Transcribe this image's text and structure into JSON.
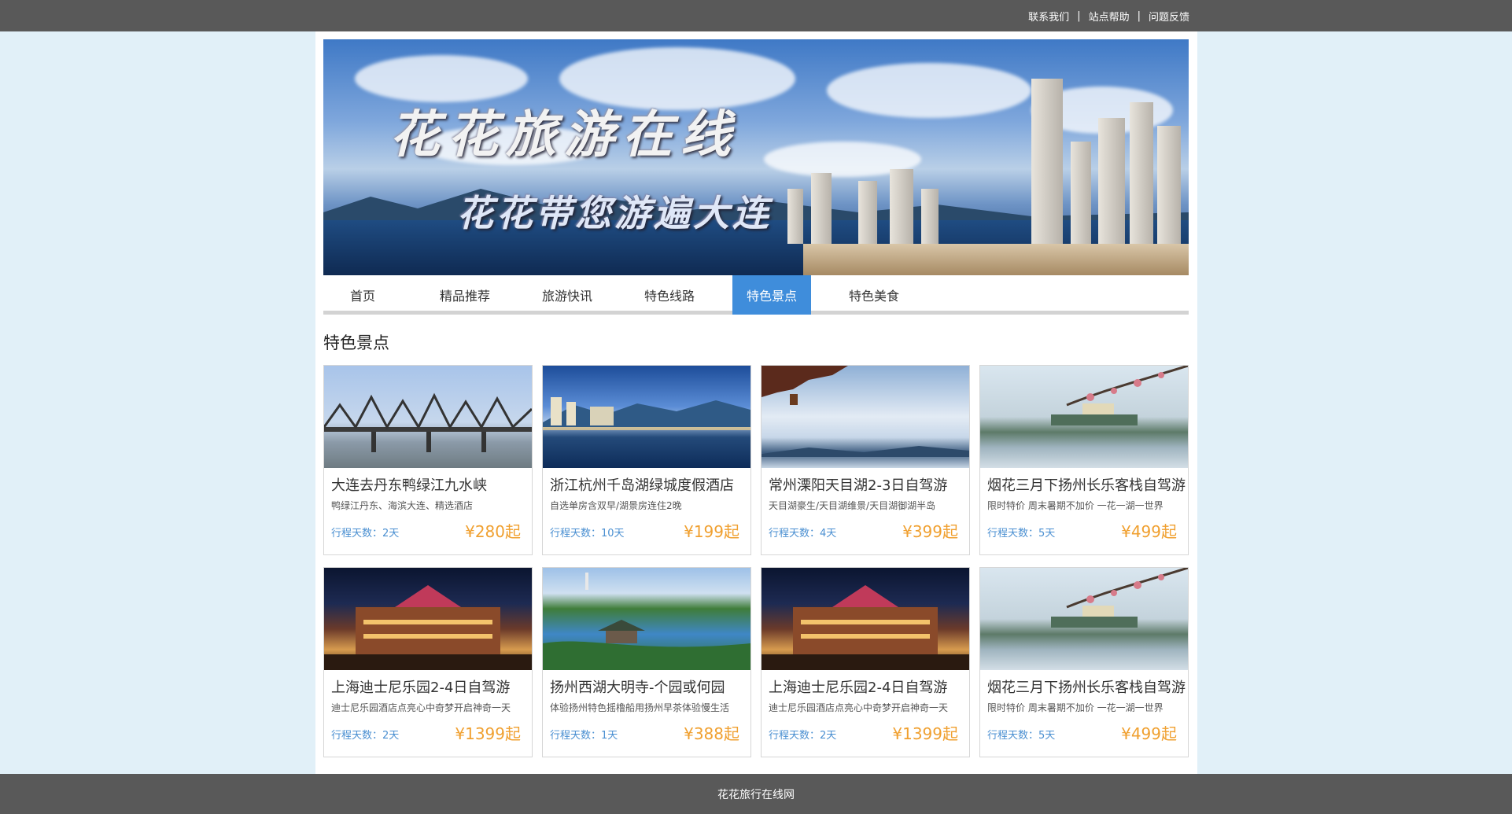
{
  "topbar": {
    "links": [
      "联系我们",
      "站点帮助",
      "问题反馈"
    ],
    "separator": "|"
  },
  "banner": {
    "title": "花花旅游在线",
    "subtitle": "花花带您游遍大连"
  },
  "nav": {
    "items": [
      "首页",
      "精品推荐",
      "旅游快讯",
      "特色线路",
      "特色景点",
      "特色美食"
    ],
    "active": "特色景点",
    "active_color": "#3f8ddb"
  },
  "section": {
    "title": "特色景点"
  },
  "cards": [
    {
      "title": "大连去丹东鸭绿江九水峡",
      "desc": "鸭绿江丹东、海滨大连、精选酒店",
      "days": "行程天数：2天",
      "price": "¥280起",
      "image": "bridge"
    },
    {
      "title": "浙江杭州千岛湖绿城度假酒店",
      "desc": "自选单房含双早/湖景房连住2晚",
      "days": "行程天数：10天",
      "price": "¥199起",
      "image": "lake"
    },
    {
      "title": "常州溧阳天目湖2-3日自驾游",
      "desc": "天目湖豪生/天目湖维景/天目湖御湖半岛",
      "days": "行程天数：4天",
      "price": "¥399起",
      "image": "sky"
    },
    {
      "title": "烟花三月下扬州长乐客栈自驾游",
      "desc": "限时特价 周末暑期不加价 一花一湖一世界",
      "days": "行程天数：5天",
      "price": "¥499起",
      "image": "mist"
    },
    {
      "title": "上海迪士尼乐园2-4日自驾游",
      "desc": "迪士尼乐园酒店点亮心中奇梦开启神奇一天",
      "days": "行程天数：2天",
      "price": "¥1399起",
      "image": "night"
    },
    {
      "title": "扬州西湖大明寺-个园或何园",
      "desc": "体验扬州特色摇橹船用扬州早茶体验慢生活",
      "days": "行程天数：1天",
      "price": "¥388起",
      "image": "garden"
    },
    {
      "title": "上海迪士尼乐园2-4日自驾游",
      "desc": "迪士尼乐园酒店点亮心中奇梦开启神奇一天",
      "days": "行程天数：2天",
      "price": "¥1399起",
      "image": "night"
    },
    {
      "title": "烟花三月下扬州长乐客栈自驾游",
      "desc": "限时特价 周末暑期不加价 一花一湖一世界",
      "days": "行程天数：5天",
      "price": "¥499起",
      "image": "mist"
    }
  ],
  "footer": {
    "text": "花花旅行在线网"
  },
  "colors": {
    "topbar_bg": "#595959",
    "page_bg": "#e1f0f8",
    "price": "#f0a030",
    "days": "#4a8fd1"
  }
}
